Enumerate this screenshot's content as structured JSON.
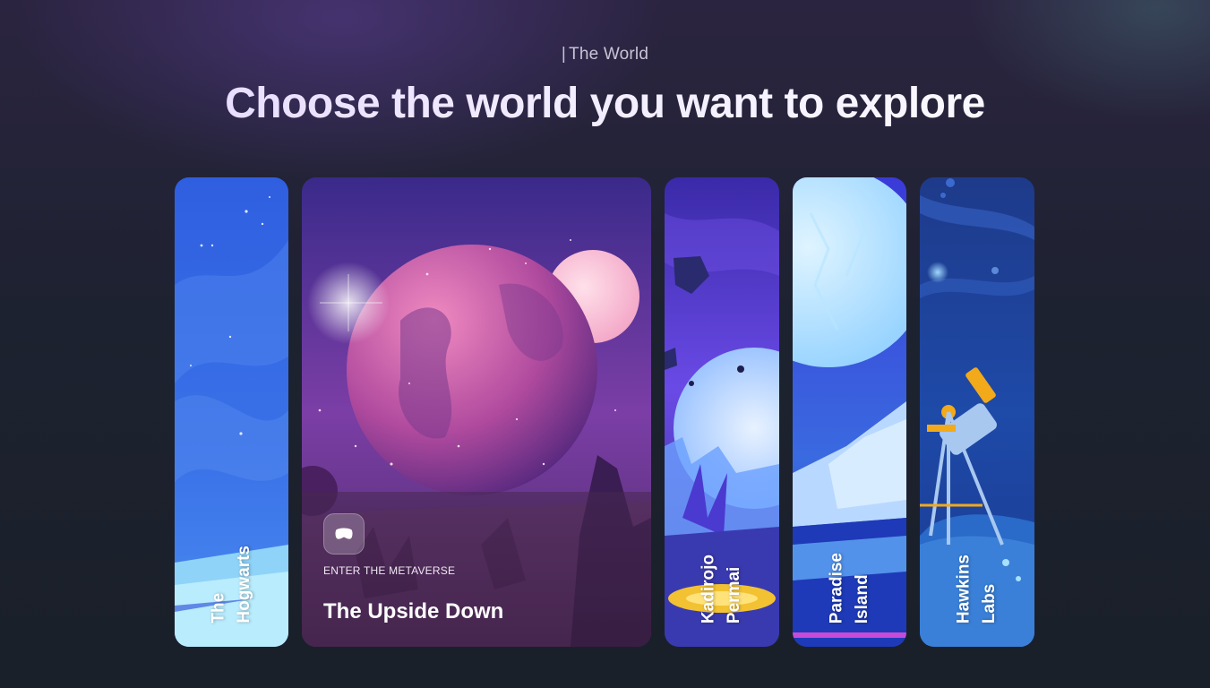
{
  "header": {
    "eyebrow": "The World",
    "title": "Choose the world you want to explore"
  },
  "cards": [
    {
      "label_lines": [
        "The",
        "Hogwarts"
      ],
      "theme": "blue-sky",
      "expanded": false
    },
    {
      "label_lines": [
        "The Upside Down"
      ],
      "kicker": "ENTER THE METAVERSE",
      "icon": "vr-headset-icon",
      "theme": "purple-planet",
      "expanded": true
    },
    {
      "label_lines": [
        "Kadirojo",
        "Permai"
      ],
      "theme": "violet-moon",
      "expanded": false
    },
    {
      "label_lines": [
        "Paradise",
        "Island"
      ],
      "theme": "ice-moon",
      "expanded": false
    },
    {
      "label_lines": [
        "Hawkins",
        "Labs"
      ],
      "theme": "telescope-night",
      "expanded": false
    }
  ],
  "colors": {
    "background": "#1d2230",
    "heading_start": "#e2d4ff",
    "heading_end": "#ffffff",
    "telescope_gold": "#f2a91a"
  }
}
